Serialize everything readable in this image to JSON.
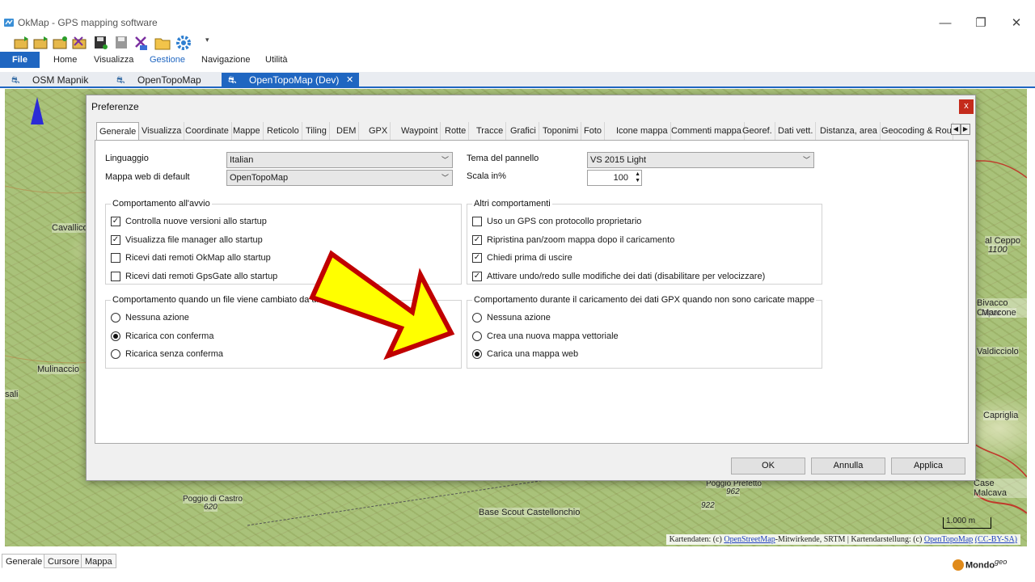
{
  "window": {
    "title": "OkMap - GPS mapping software",
    "minimize": "—",
    "restore": "❐",
    "close": "✕"
  },
  "ribbon": {
    "tabs": [
      "File",
      "Home",
      "Visualizza",
      "Gestione",
      "Navigazione",
      "Utilità"
    ],
    "active_tab": "Gestione",
    "accent": "#1f66c1"
  },
  "doc_tabs": [
    "OSM Mapnik",
    "OpenTopoMap",
    "OpenTopoMap (Dev)"
  ],
  "doc_tab_close": "✕",
  "map": {
    "labels": [
      "Cavallico",
      "Mulinaccio",
      "sali",
      "al Ceppo",
      "1100",
      "Bivacco Capar",
      "Marcone",
      "Valdicciolo",
      "Capriglia",
      "Case Malcava",
      "Poggio Prefetto",
      "962",
      "922",
      "Poggio di Castro",
      "620",
      "Base Scout Castellonchio",
      "1.000 m"
    ],
    "attribution_prefix": "Kartendaten: (c) ",
    "attribution_link1": "OpenStreetMap",
    "attribution_mid": "-Mitwirkende, SRTM | Kartendarstellung: (c) ",
    "attribution_link2": "OpenTopoMap",
    "attribution_link3": "(CC-BY-SA)"
  },
  "bottom_tabs": [
    "Generale",
    "Cursore",
    "Mappa"
  ],
  "logo": {
    "text": "Mondo",
    "sup": "geo"
  },
  "dialog": {
    "title": "Preferenze",
    "close": "x",
    "tabs": [
      "Generale",
      "Visualizza",
      "Coordinate",
      "Mappe",
      "Reticolo",
      "Tiling",
      "DEM",
      "GPX",
      "Waypoint",
      "Rotte",
      "Tracce",
      "Grafici",
      "Toponimi",
      "Foto",
      "Icone mappa",
      "Commenti mappa",
      "Georef.",
      "Dati vett.",
      "Distanza, area",
      "Geocoding & Rou"
    ],
    "active_tab": "Generale",
    "scroll_left": "◀",
    "scroll_right": "▶",
    "fields": {
      "language_label": "Linguaggio",
      "language_value": "Italian",
      "default_web_map_label": "Mappa web di default",
      "default_web_map_value": "OpenTopoMap",
      "panel_theme_label": "Tema del pannello",
      "panel_theme_value": "VS 2015 Light",
      "scale_label": "Scala in%",
      "scale_value": "100"
    },
    "startup_group": {
      "title": "Comportamento all'avvio",
      "items": [
        {
          "label": "Controlla nuove versioni allo startup",
          "checked": "✓"
        },
        {
          "label": "Visualizza file manager allo startup",
          "checked": "✓"
        },
        {
          "label": "Ricevi dati remoti OkMap allo startup",
          "checked": ""
        },
        {
          "label": "Ricevi dati remoti GpsGate allo startup",
          "checked": ""
        }
      ]
    },
    "other_group": {
      "title": "Altri comportamenti",
      "items": [
        {
          "label": "Uso un GPS con protocollo proprietario",
          "checked": ""
        },
        {
          "label": "Ripristina pan/zoom mappa dopo il caricamento",
          "checked": "✓"
        },
        {
          "label": "Chiedi prima di uscire",
          "checked": "✓"
        },
        {
          "label": "Attivare undo/redo sulle modifiche dei dati (disabilitare per velocizzare)",
          "checked": "✓"
        }
      ]
    },
    "file_change_group": {
      "title": "Comportamento quando un file viene cambiato da un altro",
      "items": [
        "Nessuna azione",
        "Ricarica con conferma",
        "Ricarica senza conferma"
      ],
      "selected_index": 1
    },
    "gpx_group": {
      "title": "Comportamento durante il caricamento dei dati GPX quando non sono caricate mappe",
      "items": [
        "Nessuna azione",
        "Crea una nuova mappa vettoriale",
        "Carica una mappa web"
      ],
      "selected_index": 2
    },
    "buttons": {
      "ok": "OK",
      "cancel": "Annulla",
      "apply": "Applica"
    }
  },
  "arrow_colors": {
    "fill": "#ffff00",
    "stroke": "#c00000"
  }
}
